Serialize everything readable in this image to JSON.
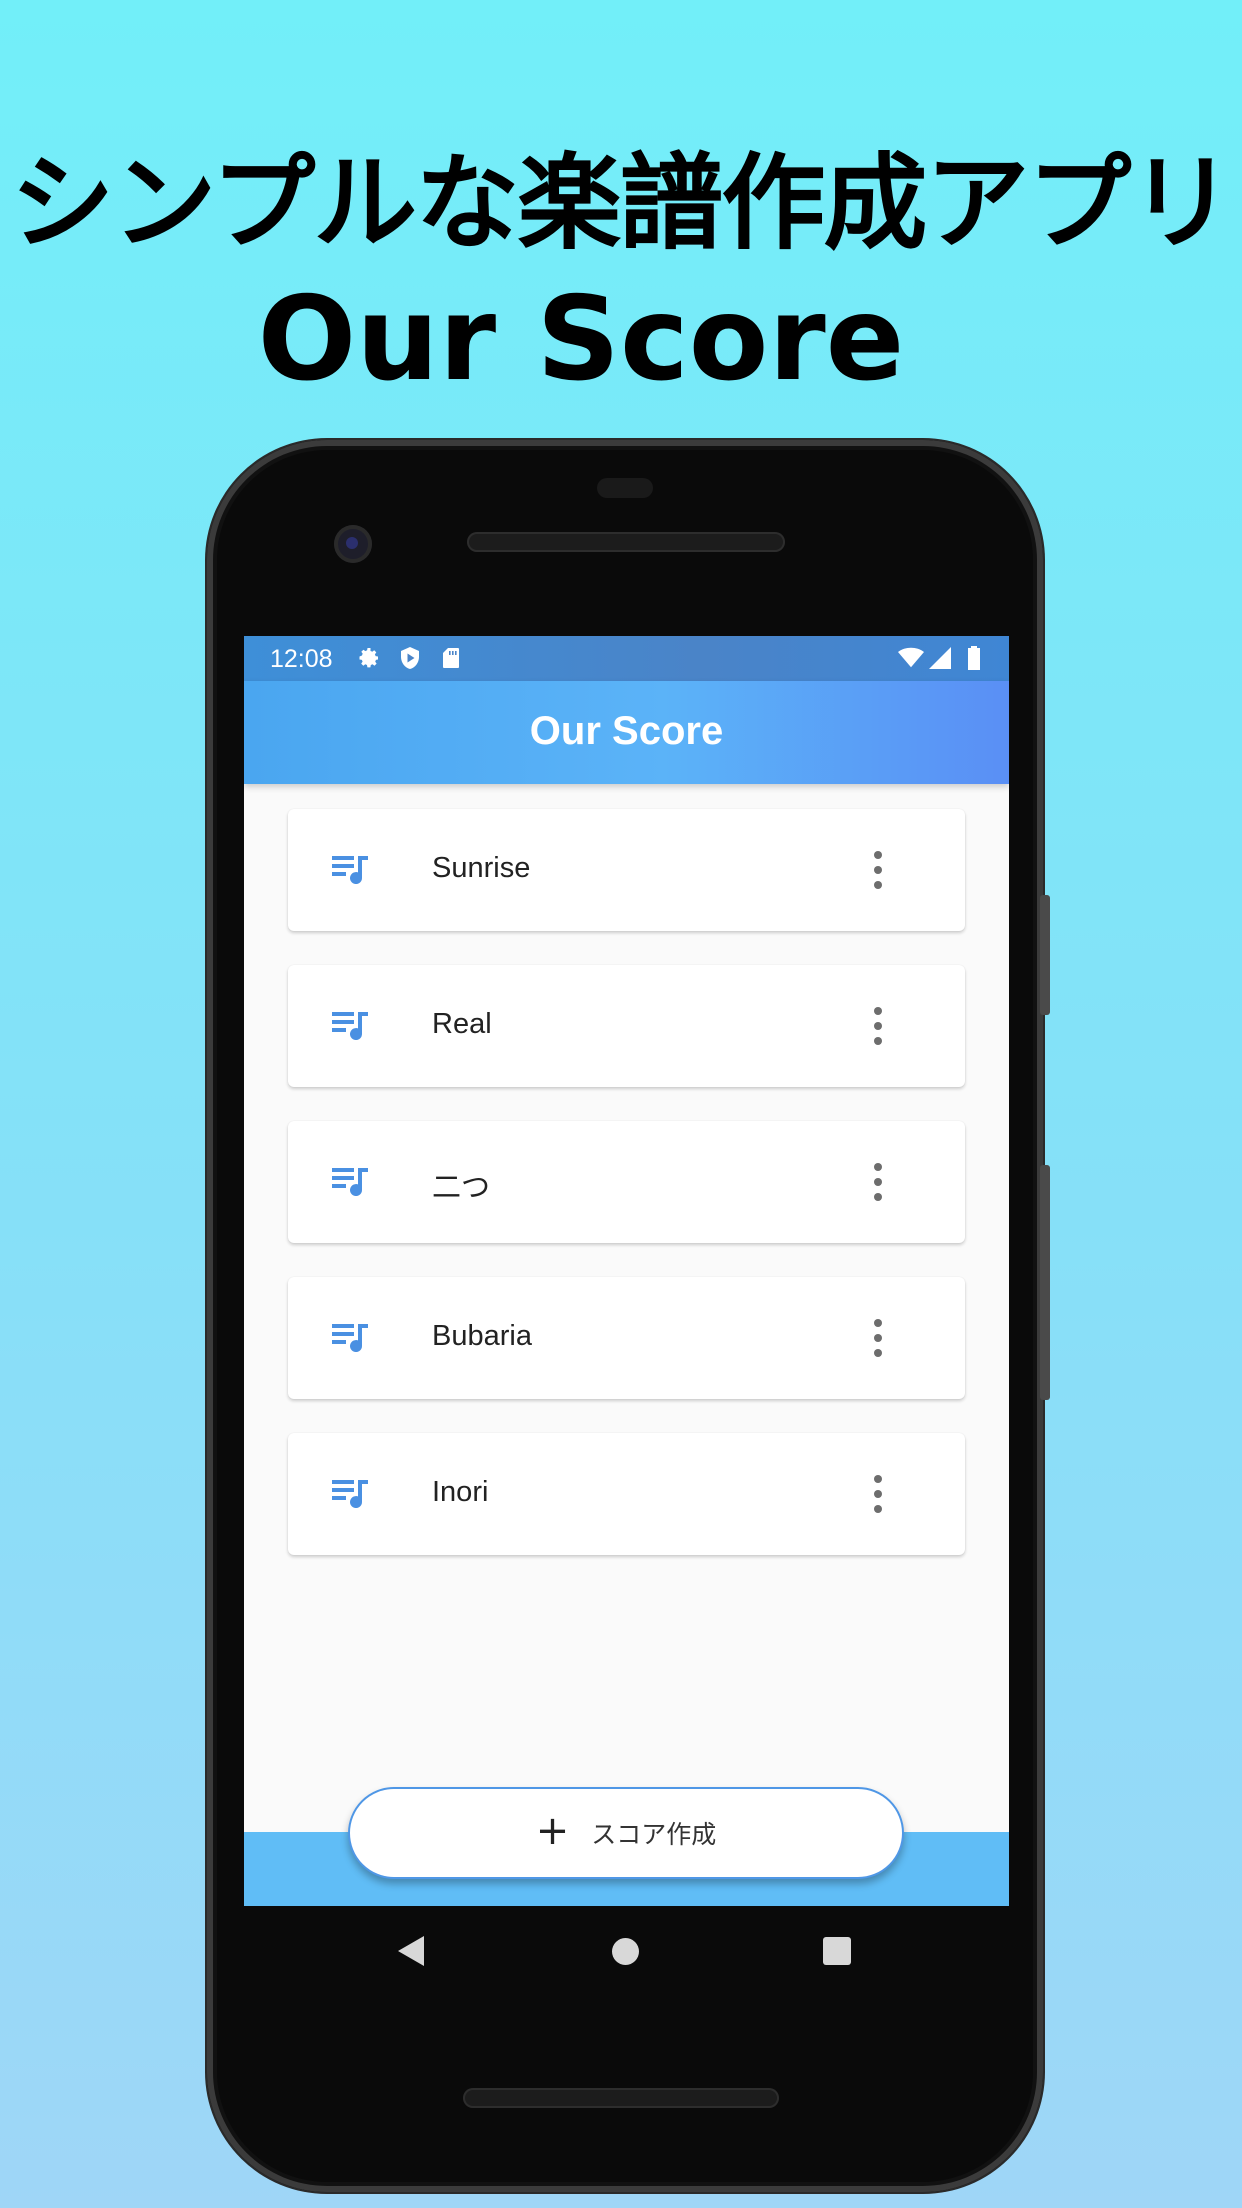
{
  "promo": {
    "headline_jp": "シンプルな楽譜作成アプリ",
    "headline_en": "Our Score"
  },
  "status_bar": {
    "time": "12:08",
    "left_icons": [
      "gear-icon",
      "shield-play-icon",
      "sd-card-icon"
    ],
    "right_icons": [
      "wifi-icon",
      "cell-signal-icon",
      "battery-icon"
    ]
  },
  "app_bar": {
    "title": "Our Score",
    "gradient": [
      "#4aa6f0",
      "#5a8ff5"
    ]
  },
  "scores": [
    {
      "title": "Sunrise"
    },
    {
      "title": "Real"
    },
    {
      "title": "二つ"
    },
    {
      "title": "Bubaria"
    },
    {
      "title": "Inori"
    }
  ],
  "list_item": {
    "icon": "playlist-music-icon",
    "menu_icon": "more-vert-icon",
    "icon_color": "#4a90e2"
  },
  "fab": {
    "icon": "plus-icon",
    "label": "スコア作成"
  },
  "nav": [
    "back-icon",
    "home-icon",
    "recents-icon"
  ],
  "colors": {
    "background_top": "#72eff9",
    "background_bottom": "#9fd6f7",
    "bottom_bar": "#60bdf6",
    "fab_border": "#4f97e6"
  }
}
